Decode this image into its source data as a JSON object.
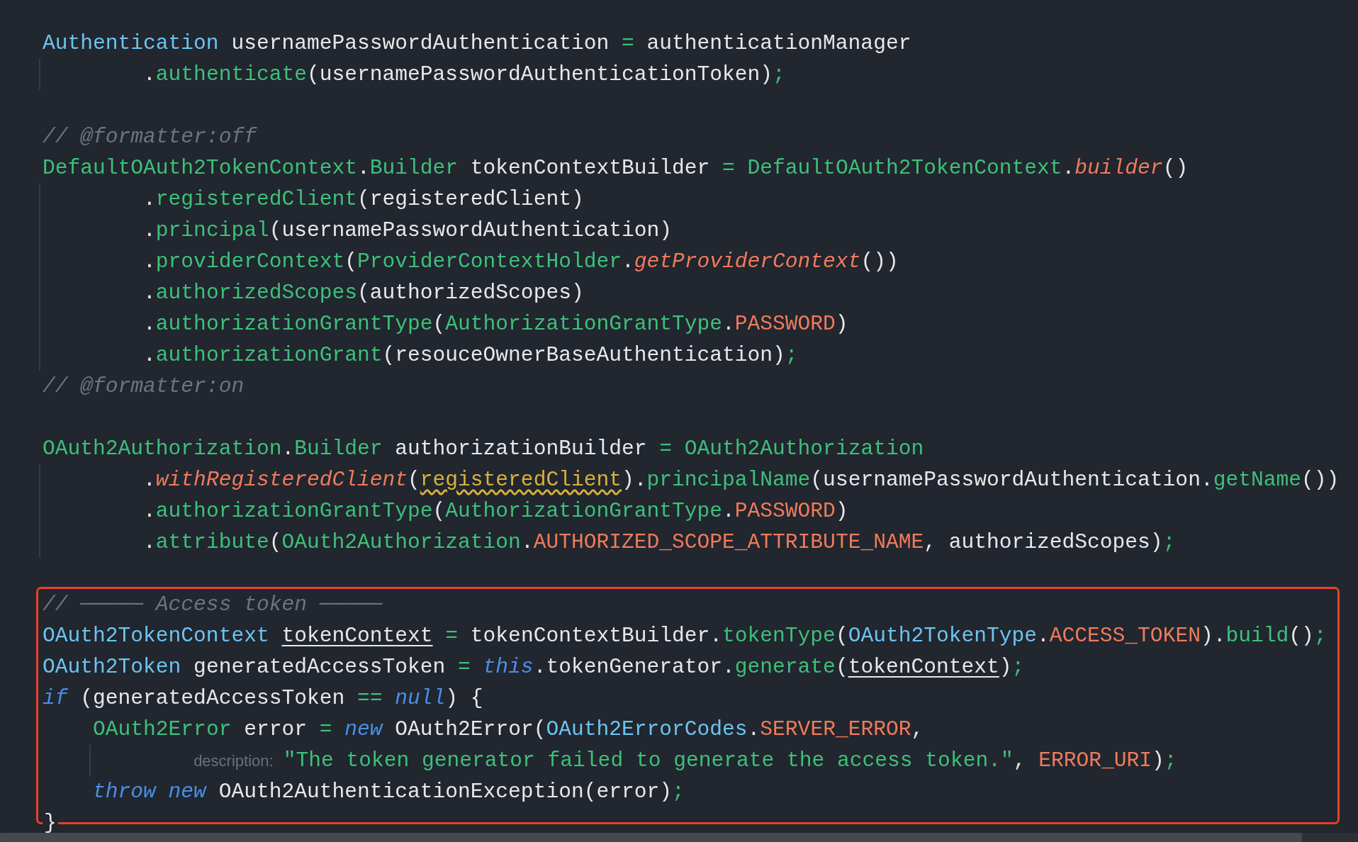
{
  "editor": {
    "sections": [
      {
        "highlighted": false,
        "lines": [
          {
            "kind": "statement",
            "tokens": [
              {
                "text": "Authentication",
                "kind": "type"
              },
              {
                "text": " usernamePasswordAuthentication ",
                "kind": "plain"
              },
              {
                "text": "=",
                "kind": "green"
              },
              {
                "text": " authenticationManager",
                "kind": "plain"
              }
            ]
          },
          {
            "kind": "continuation",
            "tokens": [
              {
                "text": ".",
                "kind": "plain"
              },
              {
                "text": "authenticate",
                "kind": "green"
              },
              {
                "text": "(usernamePasswordAuthenticationToken)",
                "kind": "plain"
              },
              {
                "text": ";",
                "kind": "green"
              }
            ]
          },
          {
            "kind": "blank"
          },
          {
            "kind": "statement",
            "tokens": [
              {
                "text": "// @formatter:off",
                "kind": "comment"
              }
            ]
          },
          {
            "kind": "statement",
            "tokens": [
              {
                "text": "DefaultOAuth2TokenContext",
                "kind": "green"
              },
              {
                "text": ".",
                "kind": "plain"
              },
              {
                "text": "Builder",
                "kind": "green"
              },
              {
                "text": " tokenContextBuilder ",
                "kind": "plain"
              },
              {
                "text": "= ",
                "kind": "green"
              },
              {
                "text": "DefaultOAuth2TokenContext",
                "kind": "green"
              },
              {
                "text": ".",
                "kind": "plain"
              },
              {
                "text": "builder",
                "kind": "static"
              },
              {
                "text": "()",
                "kind": "plain"
              }
            ]
          },
          {
            "kind": "continuation",
            "tokens": [
              {
                "text": ".",
                "kind": "plain"
              },
              {
                "text": "registeredClient",
                "kind": "green"
              },
              {
                "text": "(registeredClient)",
                "kind": "plain"
              }
            ]
          },
          {
            "kind": "continuation",
            "tokens": [
              {
                "text": ".",
                "kind": "plain"
              },
              {
                "text": "principal",
                "kind": "green"
              },
              {
                "text": "(usernamePasswordAuthentication)",
                "kind": "plain"
              }
            ]
          },
          {
            "kind": "continuation",
            "tokens": [
              {
                "text": ".",
                "kind": "plain"
              },
              {
                "text": "providerContext",
                "kind": "green"
              },
              {
                "text": "(",
                "kind": "plain"
              },
              {
                "text": "ProviderContextHolder",
                "kind": "green"
              },
              {
                "text": ".",
                "kind": "plain"
              },
              {
                "text": "getProviderContext",
                "kind": "static"
              },
              {
                "text": "())",
                "kind": "plain"
              }
            ]
          },
          {
            "kind": "continuation",
            "tokens": [
              {
                "text": ".",
                "kind": "plain"
              },
              {
                "text": "authorizedScopes",
                "kind": "green"
              },
              {
                "text": "(authorizedScopes)",
                "kind": "plain"
              }
            ]
          },
          {
            "kind": "continuation",
            "tokens": [
              {
                "text": ".",
                "kind": "plain"
              },
              {
                "text": "authorizationGrantType",
                "kind": "green"
              },
              {
                "text": "(",
                "kind": "plain"
              },
              {
                "text": "AuthorizationGrantType",
                "kind": "green"
              },
              {
                "text": ".",
                "kind": "plain"
              },
              {
                "text": "PASSWORD",
                "kind": "const"
              },
              {
                "text": ")",
                "kind": "plain"
              }
            ]
          },
          {
            "kind": "continuation",
            "tokens": [
              {
                "text": ".",
                "kind": "plain"
              },
              {
                "text": "authorizationGrant",
                "kind": "green"
              },
              {
                "text": "(resouceOwnerBaseAuthentication)",
                "kind": "plain"
              },
              {
                "text": ";",
                "kind": "green"
              }
            ]
          },
          {
            "kind": "statement",
            "tokens": [
              {
                "text": "// @formatter:on",
                "kind": "comment"
              }
            ]
          },
          {
            "kind": "blank"
          },
          {
            "kind": "statement",
            "tokens": [
              {
                "text": "OAuth2Authorization",
                "kind": "green"
              },
              {
                "text": ".",
                "kind": "plain"
              },
              {
                "text": "Builder",
                "kind": "green"
              },
              {
                "text": " authorizationBuilder ",
                "kind": "plain"
              },
              {
                "text": "= ",
                "kind": "green"
              },
              {
                "text": "OAuth2Authorization",
                "kind": "green"
              }
            ]
          },
          {
            "kind": "continuation",
            "tokens": [
              {
                "text": ".",
                "kind": "plain"
              },
              {
                "text": "withRegisteredClient",
                "kind": "static"
              },
              {
                "text": "(",
                "kind": "plain"
              },
              {
                "text": "registeredClient",
                "kind": "warning"
              },
              {
                "text": ").",
                "kind": "plain"
              },
              {
                "text": "principalName",
                "kind": "green"
              },
              {
                "text": "(usernamePasswordAuthentication.",
                "kind": "plain"
              },
              {
                "text": "getName",
                "kind": "green"
              },
              {
                "text": "())",
                "kind": "plain"
              }
            ]
          },
          {
            "kind": "continuation",
            "tokens": [
              {
                "text": ".",
                "kind": "plain"
              },
              {
                "text": "authorizationGrantType",
                "kind": "green"
              },
              {
                "text": "(",
                "kind": "plain"
              },
              {
                "text": "AuthorizationGrantType",
                "kind": "green"
              },
              {
                "text": ".",
                "kind": "plain"
              },
              {
                "text": "PASSWORD",
                "kind": "const"
              },
              {
                "text": ")",
                "kind": "plain"
              }
            ]
          },
          {
            "kind": "continuation",
            "tokens": [
              {
                "text": ".",
                "kind": "plain"
              },
              {
                "text": "attribute",
                "kind": "green"
              },
              {
                "text": "(",
                "kind": "plain"
              },
              {
                "text": "OAuth2Authorization",
                "kind": "green"
              },
              {
                "text": ".",
                "kind": "plain"
              },
              {
                "text": "AUTHORIZED_SCOPE_ATTRIBUTE_NAME",
                "kind": "const"
              },
              {
                "text": ", authorizedScopes)",
                "kind": "plain"
              },
              {
                "text": ";",
                "kind": "green"
              }
            ]
          },
          {
            "kind": "blank"
          }
        ]
      },
      {
        "highlighted": true,
        "lines": [
          {
            "kind": "statement",
            "tokens": [
              {
                "text": "// ───── Access token ─────",
                "kind": "comment"
              }
            ]
          },
          {
            "kind": "statement",
            "tokens": [
              {
                "text": "OAuth2TokenContext ",
                "kind": "type"
              },
              {
                "text": "tokenContext",
                "kind": "underlined"
              },
              {
                "text": " = ",
                "kind": "green"
              },
              {
                "text": "tokenContextBuilder.",
                "kind": "plain"
              },
              {
                "text": "tokenType",
                "kind": "green"
              },
              {
                "text": "(",
                "kind": "plain"
              },
              {
                "text": "OAuth2TokenType",
                "kind": "type"
              },
              {
                "text": ".",
                "kind": "plain"
              },
              {
                "text": "ACCESS_TOKEN",
                "kind": "const"
              },
              {
                "text": ").",
                "kind": "plain"
              },
              {
                "text": "build",
                "kind": "green"
              },
              {
                "text": "()",
                "kind": "plain"
              },
              {
                "text": ";",
                "kind": "green"
              }
            ]
          },
          {
            "kind": "statement",
            "tokens": [
              {
                "text": "OAuth2Token",
                "kind": "type"
              },
              {
                "text": " generatedAccessToken ",
                "kind": "plain"
              },
              {
                "text": "= ",
                "kind": "green"
              },
              {
                "text": "this",
                "kind": "keyword"
              },
              {
                "text": ".tokenGenerator.",
                "kind": "plain"
              },
              {
                "text": "generate",
                "kind": "green"
              },
              {
                "text": "(",
                "kind": "plain"
              },
              {
                "text": "tokenContext",
                "kind": "underlined"
              },
              {
                "text": ")",
                "kind": "plain"
              },
              {
                "text": ";",
                "kind": "green"
              }
            ]
          },
          {
            "kind": "statement",
            "tokens": [
              {
                "text": "if",
                "kind": "keyword"
              },
              {
                "text": " (generatedAccessToken ",
                "kind": "plain"
              },
              {
                "text": "== ",
                "kind": "green"
              },
              {
                "text": "null",
                "kind": "keyword"
              },
              {
                "text": ") {",
                "kind": "plain"
              }
            ]
          },
          {
            "kind": "block",
            "tokens": [
              {
                "text": "OAuth2Error",
                "kind": "green"
              },
              {
                "text": " error ",
                "kind": "plain"
              },
              {
                "text": "= ",
                "kind": "green"
              },
              {
                "text": "new",
                "kind": "keyword"
              },
              {
                "text": " OAuth2Error(",
                "kind": "plain"
              },
              {
                "text": "OAuth2ErrorCodes",
                "kind": "type"
              },
              {
                "text": ".",
                "kind": "plain"
              },
              {
                "text": "SERVER_ERROR",
                "kind": "const"
              },
              {
                "text": ",",
                "kind": "plain"
              }
            ]
          },
          {
            "kind": "block-continuation",
            "tokens": [
              {
                "text": "description:",
                "kind": "hint"
              },
              {
                "text": "\"The token generator failed to generate the access token.\"",
                "kind": "string"
              },
              {
                "text": ", ",
                "kind": "plain"
              },
              {
                "text": "ERROR_URI",
                "kind": "const"
              },
              {
                "text": ")",
                "kind": "plain"
              },
              {
                "text": ";",
                "kind": "green"
              }
            ]
          },
          {
            "kind": "block",
            "tokens": [
              {
                "text": "throw new",
                "kind": "keyword"
              },
              {
                "text": " OAuth2AuthenticationException(error)",
                "kind": "plain"
              },
              {
                "text": ";",
                "kind": "green"
              }
            ]
          }
        ]
      },
      {
        "highlighted": false,
        "lines": [
          {
            "kind": "statement",
            "tokens": [
              {
                "text": "}",
                "kind": "plain"
              }
            ]
          }
        ]
      }
    ]
  }
}
